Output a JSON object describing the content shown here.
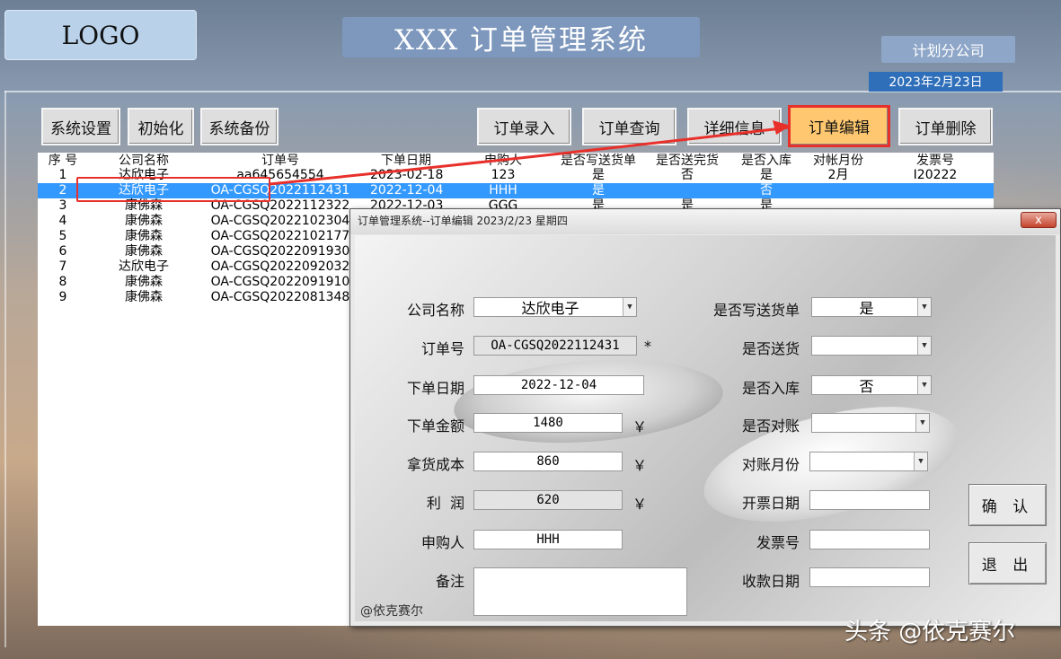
{
  "header": {
    "logo": "LOGO",
    "title": "XXX 订单管理系统",
    "company": "计划分公司",
    "date": "2023年2月23日"
  },
  "toolbar_left": [
    "系统设置",
    "初始化",
    "系统备份"
  ],
  "toolbar_right": [
    "订单录入",
    "订单查询",
    "详细信息",
    "订单编辑",
    "订单删除"
  ],
  "grid": {
    "columns": [
      "序 号",
      "公司名称",
      "订单号",
      "下单日期",
      "申购人",
      "是否写送货单",
      "是否送完货",
      "是否入库",
      "对帐月份",
      "发票号"
    ],
    "rows": [
      [
        "1",
        "达欣电子",
        "aa645654554",
        "2023-02-18",
        "123",
        "是",
        "否",
        "是",
        "2月",
        "I20222"
      ],
      [
        "2",
        "达欣电子",
        "OA-CGSQ2022112431",
        "2022-12-04",
        "HHH",
        "是",
        "",
        "否",
        "",
        ""
      ],
      [
        "3",
        "康佛森",
        "OA-CGSQ2022112322",
        "2022-12-03",
        "GGG",
        "是",
        "是",
        "是",
        "",
        ""
      ],
      [
        "4",
        "康佛森",
        "OA-CGSQ2022102304",
        "",
        "",
        "",
        "",
        "",
        "",
        ""
      ],
      [
        "5",
        "康佛森",
        "OA-CGSQ2022102177",
        "",
        "",
        "",
        "",
        "",
        "",
        ""
      ],
      [
        "6",
        "康佛森",
        "OA-CGSQ2022091930",
        "",
        "",
        "",
        "",
        "",
        "",
        ""
      ],
      [
        "7",
        "达欣电子",
        "OA-CGSQ2022092032",
        "",
        "",
        "",
        "",
        "",
        "",
        ""
      ],
      [
        "8",
        "康佛森",
        "OA-CGSQ2022091910",
        "",
        "",
        "",
        "",
        "",
        "",
        ""
      ],
      [
        "9",
        "康佛森",
        "OA-CGSQ2022081348",
        "",
        "",
        "",
        "",
        "",
        "",
        ""
      ]
    ]
  },
  "dialog": {
    "title": "订单管理系统--订单编辑 2023/2/23 星期四",
    "close": "x",
    "left_fields": {
      "company_label": "公司名称",
      "company_value": "达欣电子",
      "order_label": "订单号",
      "order_value": "OA-CGSQ2022112431",
      "order_mark": "*",
      "date_label": "下单日期",
      "date_value": "2022-12-04",
      "amount_label": "下单金额",
      "amount_value": "1480",
      "cost_label": "拿货成本",
      "cost_value": "860",
      "profit_label": "利  润",
      "profit_value": "620",
      "buyer_label": "申购人",
      "buyer_value": "HHH",
      "remark_label": "备注",
      "remark_value": "",
      "currency": "￥"
    },
    "right_fields": {
      "delivery_note_label": "是否写送货单",
      "delivery_note_value": "是",
      "delivered_label": "是否送货",
      "delivered_value": "",
      "stocked_label": "是否入库",
      "stocked_value": "否",
      "reconciled_label": "是否对账",
      "reconciled_value": "",
      "month_label": "对账月份",
      "month_value": "",
      "invoice_date_label": "开票日期",
      "invoice_date_value": "",
      "invoice_no_label": "发票号",
      "invoice_no_value": "",
      "payment_date_label": "收款日期",
      "payment_date_value": ""
    },
    "confirm": "确 认",
    "exit": "退 出",
    "footer": "@依克赛尔"
  },
  "watermark": "头条 @依克赛尔",
  "colors": {
    "accent": "#3399ff",
    "highlight": "#e8302b",
    "active_button": "#ffc870"
  }
}
